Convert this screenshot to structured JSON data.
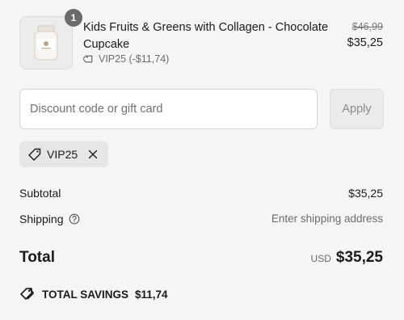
{
  "product": {
    "quantity": "1",
    "title": "Kids Fruits & Greens with Collagen - Chocolate Cupcake",
    "discount_text": "VIP25 (-$11,74)",
    "original_price": "$46,99",
    "price": "$35,25",
    "image_icon": "product-jar-icon"
  },
  "discount": {
    "placeholder": "Discount code or gift card",
    "value": "",
    "apply_label": "Apply",
    "applied_code": "VIP25"
  },
  "summary": {
    "subtotal_label": "Subtotal",
    "subtotal_value": "$35,25",
    "shipping_label": "Shipping",
    "shipping_value": "Enter shipping address",
    "total_label": "Total",
    "currency": "USD",
    "total_value": "$35,25",
    "savings_label": "TOTAL SAVINGS",
    "savings_value": "$11,74"
  },
  "colors": {
    "background": "#f5f5f5",
    "badge": "#6b6b6b",
    "chip": "#e6e6e6"
  }
}
